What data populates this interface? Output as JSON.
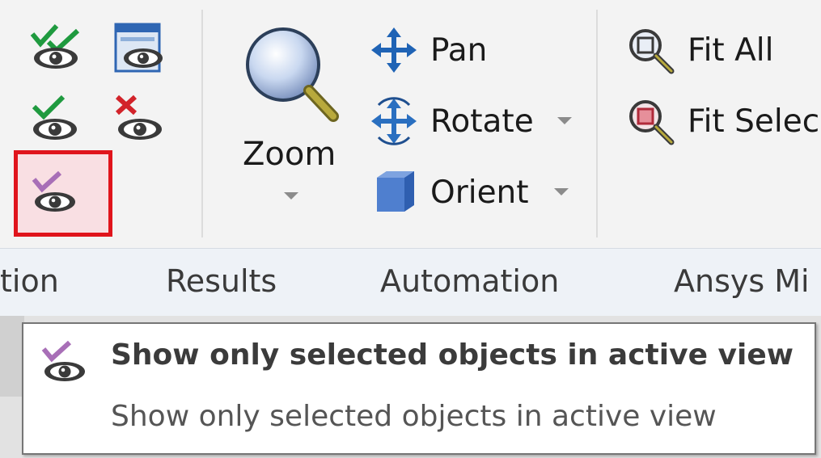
{
  "ribbon": {
    "visibility_group": {
      "items": [
        {
          "name": "show-checked-icon",
          "state": "normal"
        },
        {
          "name": "show-in-window-icon",
          "state": "normal"
        },
        {
          "name": "show-selected-icon",
          "state": "normal"
        },
        {
          "name": "hide-selected-icon",
          "state": "normal"
        },
        {
          "name": "show-only-selected-icon",
          "state": "highlighted"
        }
      ],
      "highlight_color": "#e0141c"
    },
    "navigate_group": {
      "zoom_label": "Zoom",
      "pan_label": "Pan",
      "rotate_label": "Rotate",
      "orient_label": "Orient"
    },
    "fit_group": {
      "fit_all_label": "Fit All",
      "fit_selected_label": "Fit Selec"
    }
  },
  "tabs": [
    {
      "label": "tion"
    },
    {
      "label": "Results"
    },
    {
      "label": "Automation"
    },
    {
      "label": "Ansys Mi"
    }
  ],
  "tooltip": {
    "title": "Show only selected objects in active view",
    "description": "Show only selected objects in active view"
  },
  "colors": {
    "check_green": "#1f9a3f",
    "cross_red": "#d2232a",
    "check_purple": "#a86fb7",
    "arrow_blue": "#1f63b5",
    "accent_red": "#e0141c"
  }
}
